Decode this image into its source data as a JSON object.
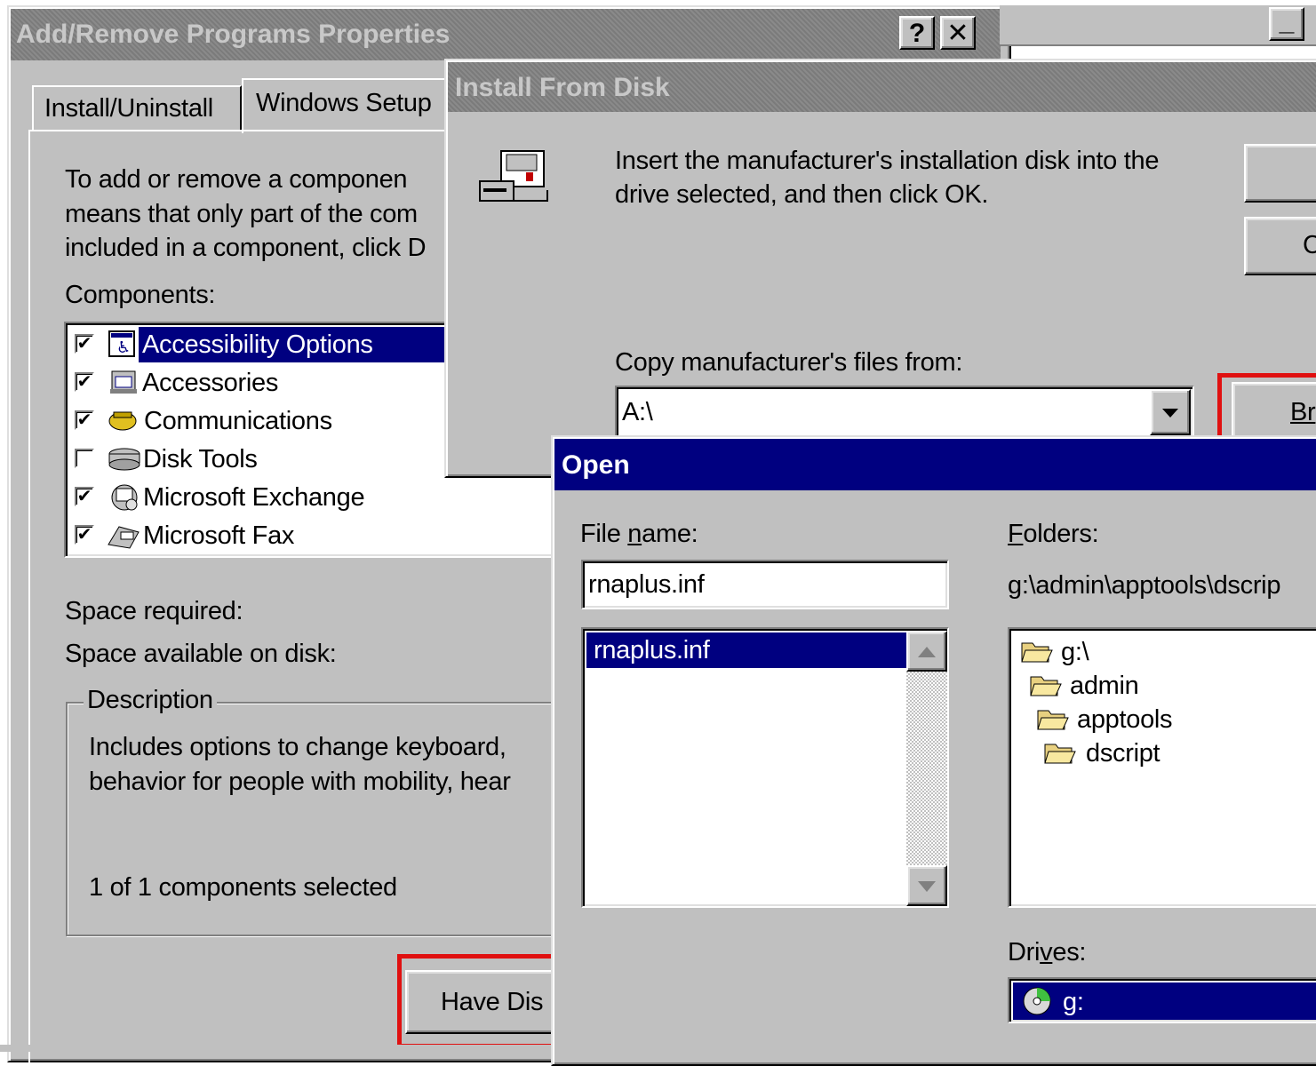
{
  "add_remove": {
    "title": "Add/Remove Programs Properties",
    "help_label": "?",
    "close_label": "✕",
    "minimize_label": "_",
    "tabs": [
      "Install/Uninstall",
      "Windows Setup"
    ],
    "intro_lines": [
      "To add or remove a componen",
      "means that only part of the com",
      "included in a component, click D"
    ],
    "components_label": "Components:",
    "components": [
      {
        "label": "Accessibility Options",
        "checked": true,
        "selected": true,
        "icon": "accessibility-icon"
      },
      {
        "label": "Accessories",
        "checked": true,
        "selected": false,
        "icon": "accessories-icon"
      },
      {
        "label": "Communications",
        "checked": true,
        "selected": false,
        "icon": "phone-icon"
      },
      {
        "label": "Disk Tools",
        "checked": false,
        "selected": false,
        "icon": "disk-icon"
      },
      {
        "label": "Microsoft Exchange",
        "checked": true,
        "selected": false,
        "icon": "exchange-icon"
      },
      {
        "label": "Microsoft Fax",
        "checked": true,
        "selected": false,
        "icon": "fax-icon"
      }
    ],
    "space_required_label": "Space required:",
    "space_available_label": "Space available on disk:",
    "description_label": "Description",
    "description_lines": [
      "Includes options to change keyboard,",
      "behavior for people with mobility, hear"
    ],
    "selection_count": "1 of 1 components selected",
    "have_disk_button": "Have Dis",
    "bottom_cutoff_text": "Add/Remove Programs Properties"
  },
  "install_from_disk": {
    "title": "Install From Disk",
    "message_lines": [
      "Insert the manufacturer's installation disk into the",
      "drive selected, and then click OK."
    ],
    "copy_from_label": "Copy manufacturer's files from:",
    "copy_from_value": "A:\\",
    "browse_button": "Br",
    "cancel_button_fragment": "C"
  },
  "open_dialog": {
    "title": "Open",
    "file_name_label": "File name:",
    "file_name_value": "rnaplus.inf",
    "files": [
      "rnaplus.inf"
    ],
    "folders_label": "Folders:",
    "current_path": "g:\\admin\\apptools\\dscrip",
    "folder_tree": [
      "g:\\",
      "admin",
      "apptools",
      "dscript"
    ],
    "drives_label": "Drives:",
    "drive_value": "g:"
  },
  "colors": {
    "face": "#c0c0c0",
    "active_title": "#000080",
    "highlight_box": "#e01010"
  }
}
